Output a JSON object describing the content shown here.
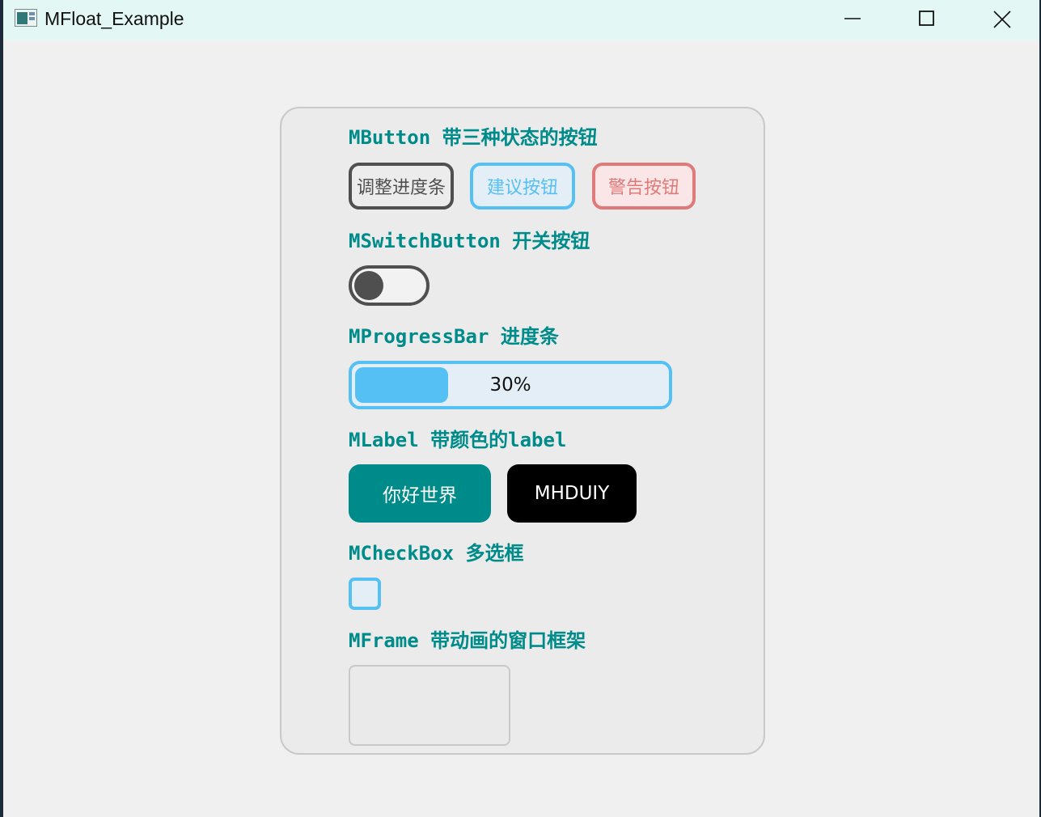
{
  "window": {
    "title": "MFloat_Example",
    "controls": {
      "minimize": "minimize",
      "maximize": "maximize",
      "close": "close"
    }
  },
  "sections": {
    "button": {
      "title": "MButton 带三种状态的按钮"
    },
    "switch": {
      "title": "MSwitchButton 开关按钮"
    },
    "progress": {
      "title": "MProgressBar 进度条"
    },
    "label": {
      "title": "MLabel 带颜色的label"
    },
    "checkbox": {
      "title": "MCheckBox 多选框"
    },
    "frame": {
      "title": "MFrame 带动画的窗口框架"
    }
  },
  "buttons": {
    "adjust": "调整进度条",
    "suggest": "建议按钮",
    "warn": "警告按钮"
  },
  "switch_button": {
    "on": false
  },
  "progress_bar": {
    "value": 30,
    "text": "30%"
  },
  "labels": {
    "teal": "你好世界",
    "black": "MHDUIY"
  },
  "checkbox": {
    "checked": false
  },
  "colors": {
    "accent_teal": "#008b8b",
    "info_blue": "#55c0f3",
    "warn_red": "#e07a7a",
    "neutral_gray": "#4f4f4f",
    "titlebar": "#e3f7f5"
  }
}
